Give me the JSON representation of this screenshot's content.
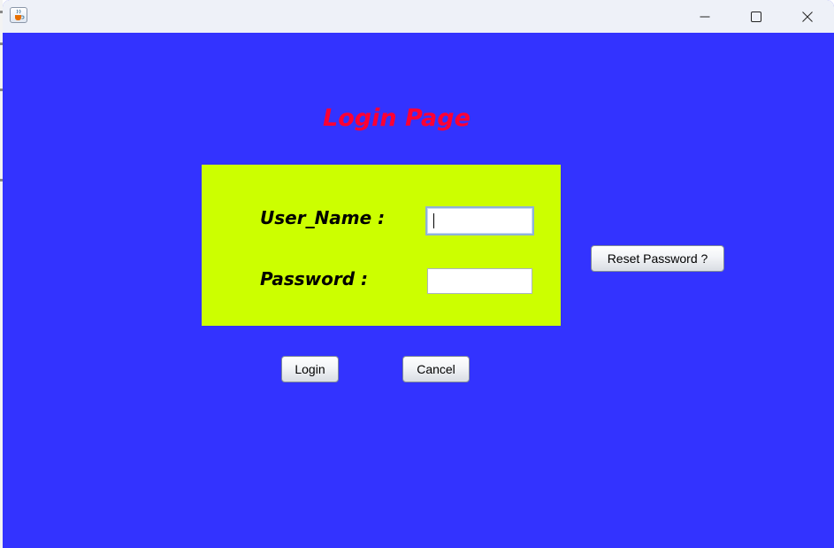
{
  "window": {
    "icon": "java-cup-icon",
    "controls": [
      "minimize-icon",
      "maximize-icon",
      "close-icon"
    ]
  },
  "colors": {
    "background": "#3333ff",
    "panel": "#ccff00",
    "title": "#ff0033"
  },
  "page": {
    "title": "Login Page"
  },
  "form": {
    "username_label": "User_Name :",
    "username_value": "",
    "password_label": "Password :",
    "password_value": ""
  },
  "buttons": {
    "login": "Login",
    "cancel": "Cancel",
    "reset_password": "Reset Password ?"
  }
}
